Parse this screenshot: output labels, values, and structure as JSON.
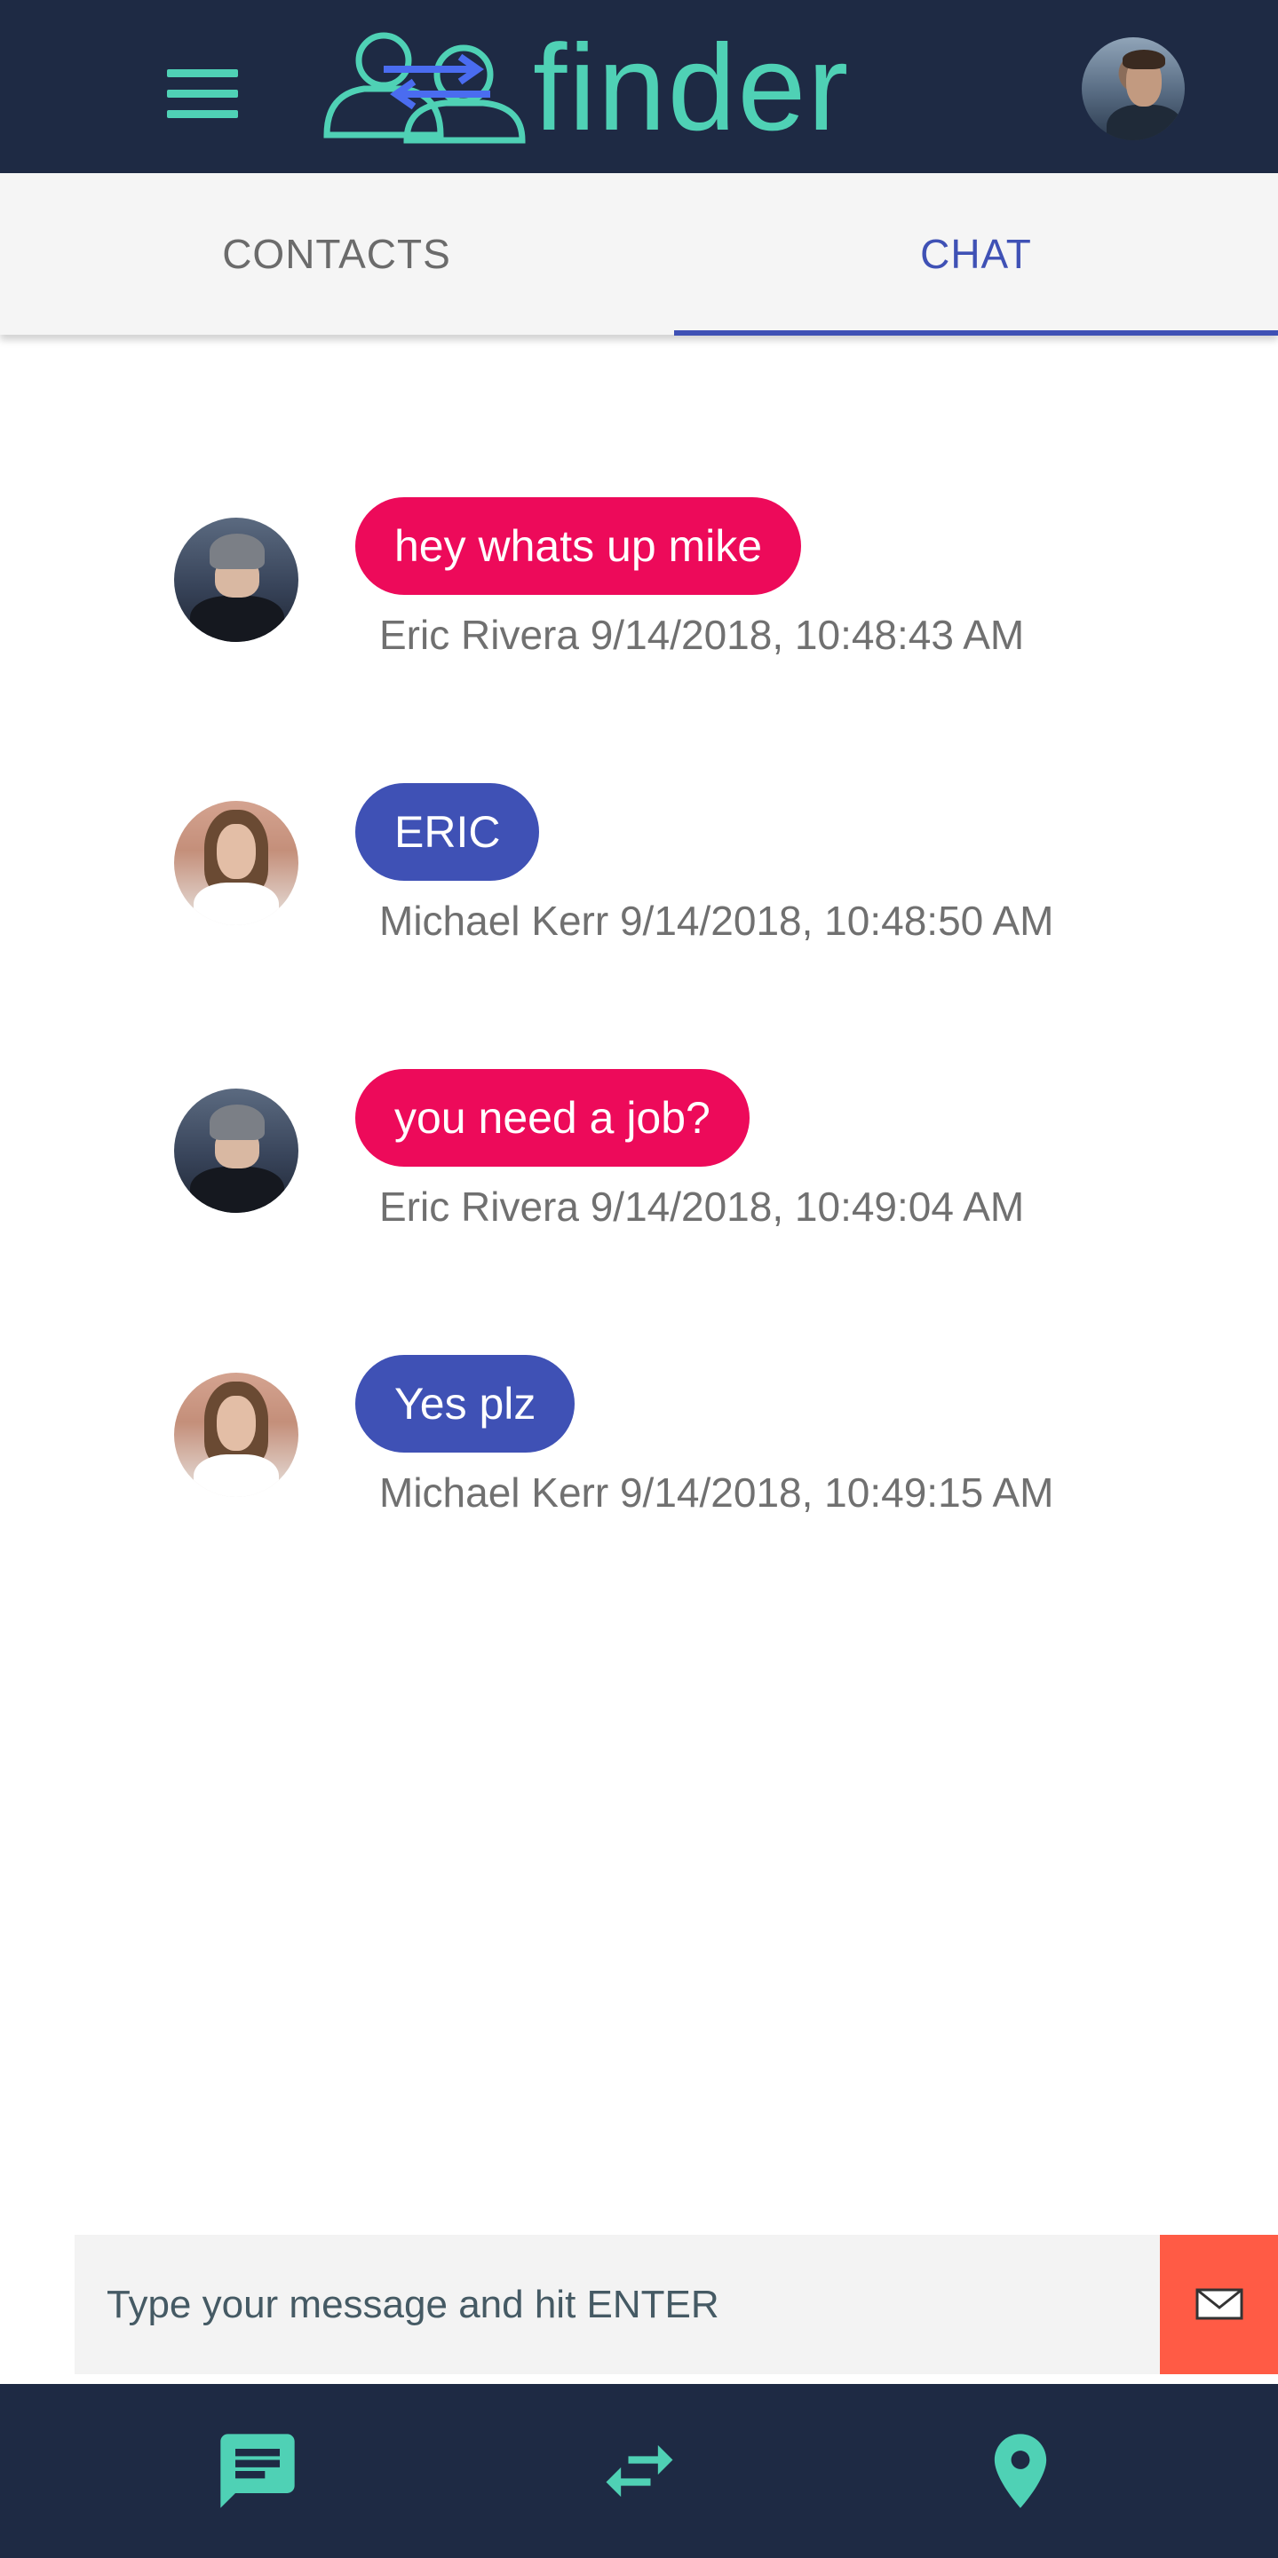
{
  "app": {
    "brand": "finder"
  },
  "colors": {
    "bar_bg": "#1e2a44",
    "accent_teal": "#4fd1b5",
    "tab_active": "#3f51b5",
    "bubble_pink": "#ed0a5a",
    "bubble_blue": "#3f51b5",
    "send_button": "#ff5b45"
  },
  "header": {
    "menu_icon": "hamburger-menu-icon",
    "account_avatar": "user-avatar"
  },
  "tabs": [
    {
      "label": "CONTACTS",
      "active": false
    },
    {
      "label": "CHAT",
      "active": true
    }
  ],
  "messages": [
    {
      "text": "hey whats up mike",
      "sender": "Eric Rivera",
      "meta": "Eric Rivera 9/14/2018, 10:48:43 AM",
      "color": "pink"
    },
    {
      "text": "ERIC",
      "sender": "Michael Kerr",
      "meta": "Michael Kerr 9/14/2018, 10:48:50 AM",
      "color": "blue"
    },
    {
      "text": "you need a job?",
      "sender": "Eric Rivera",
      "meta": "Eric Rivera 9/14/2018, 10:49:04 AM",
      "color": "pink"
    },
    {
      "text": "Yes plz",
      "sender": "Michael Kerr",
      "meta": "Michael Kerr 9/14/2018, 10:49:15 AM",
      "color": "blue"
    }
  ],
  "composer": {
    "placeholder": "Type your message and hit ENTER",
    "value": "",
    "send_icon": "envelope-icon"
  },
  "bottom_nav": [
    {
      "icon": "chat-icon"
    },
    {
      "icon": "swap-arrows-icon"
    },
    {
      "icon": "location-pin-icon"
    }
  ]
}
